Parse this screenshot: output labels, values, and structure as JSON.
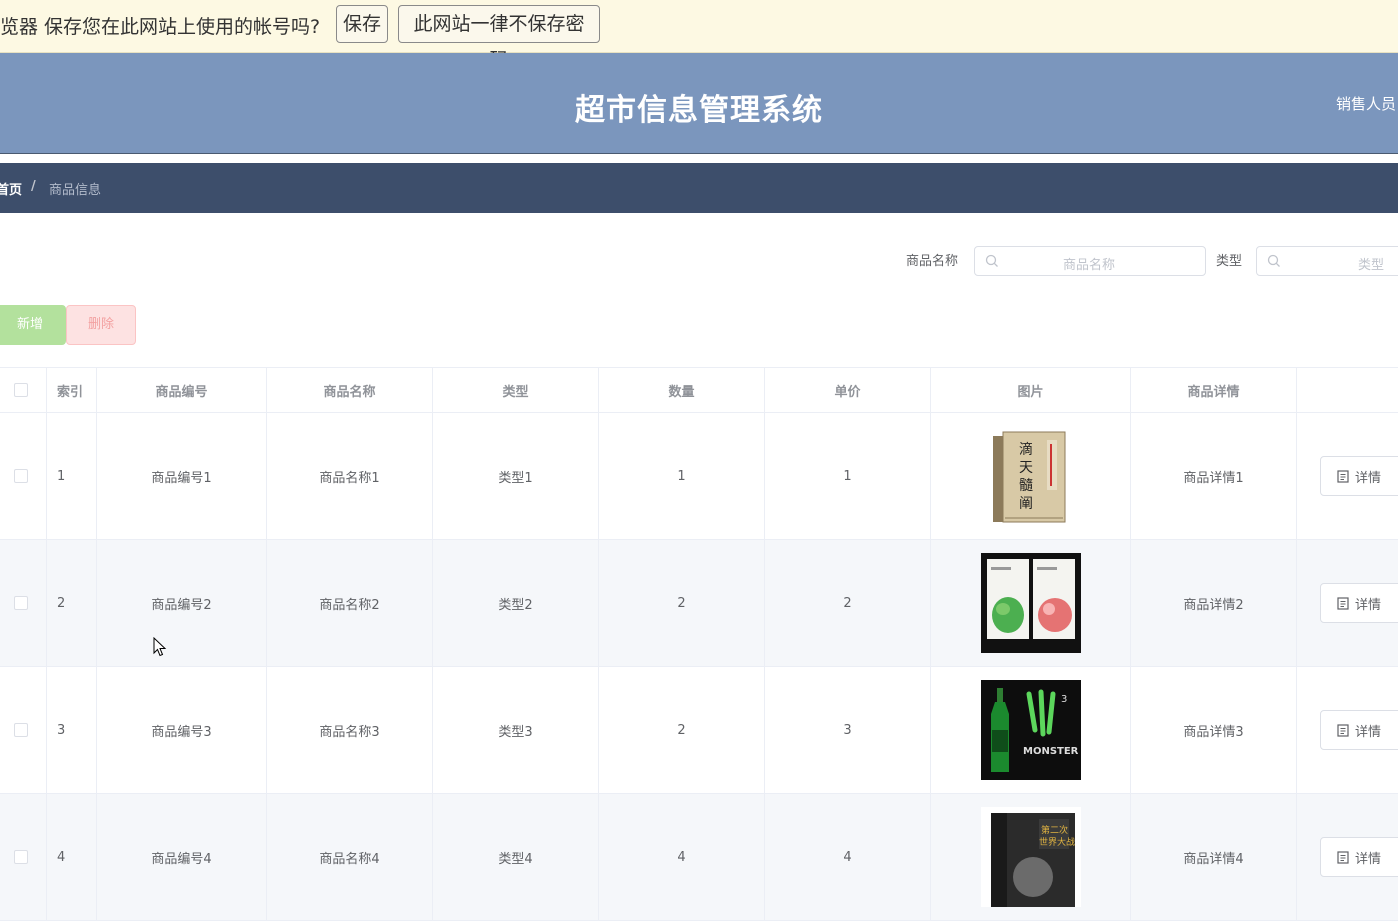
{
  "password_bar": {
    "message": "览器 保存您在此网站上使用的帐号吗?",
    "save_label": "保存",
    "never_label": "此网站一律不保存密码"
  },
  "header": {
    "title": "超市信息管理系统",
    "user": "销售人员"
  },
  "breadcrumb": {
    "home": "首页",
    "separator": "/",
    "current": "商品信息"
  },
  "search": {
    "name_label": "商品名称",
    "name_placeholder": "商品名称",
    "type_label": "类型",
    "type_placeholder": "类型"
  },
  "actions": {
    "add_label": "新增",
    "delete_label": "删除"
  },
  "table": {
    "columns": [
      "索引",
      "商品编号",
      "商品名称",
      "类型",
      "数量",
      "单价",
      "图片",
      "商品详情"
    ],
    "detail_button_label": "详情",
    "rows": [
      {
        "index": "1",
        "code": "商品编号1",
        "name": "商品名称1",
        "type": "类型1",
        "qty": "1",
        "price": "1",
        "image": "book-cover",
        "detail": "商品详情1"
      },
      {
        "index": "2",
        "code": "商品编号2",
        "name": "商品名称2",
        "type": "类型2",
        "qty": "2",
        "price": "2",
        "image": "face-mask-packs",
        "detail": "商品详情2"
      },
      {
        "index": "3",
        "code": "商品编号3",
        "name": "商品名称3",
        "type": "类型3",
        "qty": "2",
        "price": "3",
        "image": "energy-drink-bottle",
        "detail": "商品详情3"
      },
      {
        "index": "4",
        "code": "商品编号4",
        "name": "商品名称4",
        "type": "类型4",
        "qty": "4",
        "price": "4",
        "image": "boxed-book-set",
        "detail": "商品详情4"
      }
    ]
  },
  "colors": {
    "header_bg": "#7b96bd",
    "breadcrumb_bg": "#3d4e6b",
    "password_bar_bg": "#fdf9e3",
    "add_button": "#b3e19d",
    "delete_button": "#fde2e2"
  }
}
